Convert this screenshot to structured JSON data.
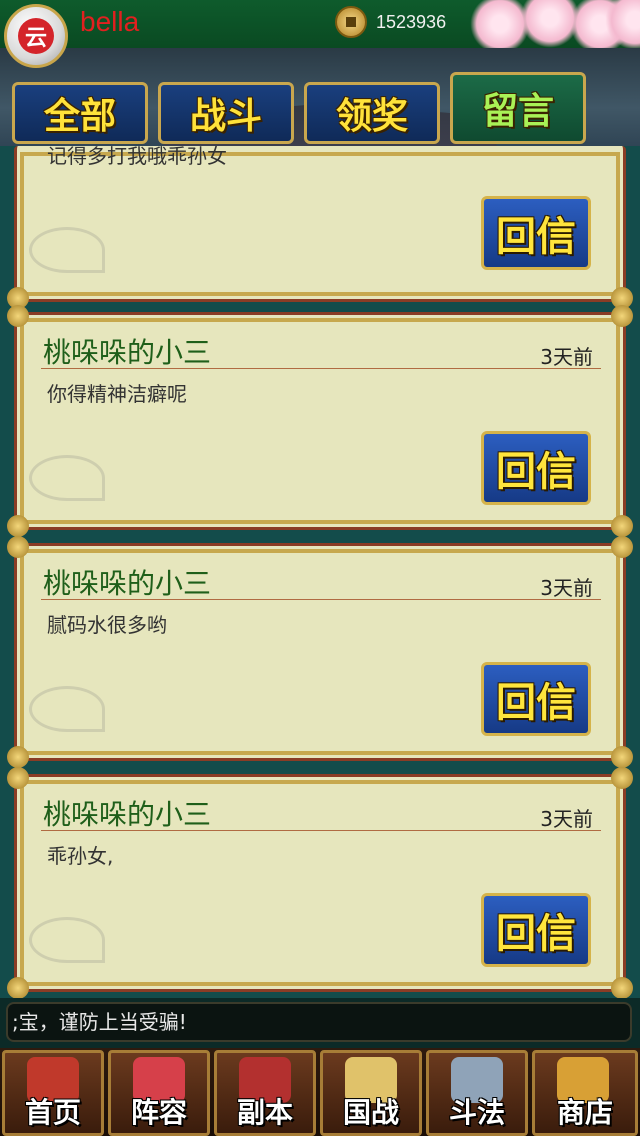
{
  "header": {
    "avatar_glyph": "云",
    "username": "bella",
    "coin_count": "1523936"
  },
  "tabs": [
    {
      "label": "全部",
      "active": false
    },
    {
      "label": "战斗",
      "active": false
    },
    {
      "label": "领奖",
      "active": false
    },
    {
      "label": "留言",
      "active": true
    }
  ],
  "messages": {
    "partial_text": "记得多打我哦乖孙女",
    "reply_label": "回信",
    "items": [
      {
        "sender": "桃哚哚的小三",
        "time": "3天前",
        "text": "你得精神洁癖呢"
      },
      {
        "sender": "桃哚哚的小三",
        "time": "3天前",
        "text": "腻码水很多哟"
      },
      {
        "sender": "桃哚哚的小三",
        "time": "3天前",
        "text": "乖孙女,"
      }
    ]
  },
  "marquee": {
    "text": ";宝，谨防上当受骗!"
  },
  "bottom_nav": [
    {
      "label": "首页",
      "icon": "home-icon",
      "color": "#c0392b"
    },
    {
      "label": "阵容",
      "icon": "lineup-icon",
      "color": "#d6404a"
    },
    {
      "label": "副本",
      "icon": "dungeon-icon",
      "color": "#b3302f"
    },
    {
      "label": "国战",
      "icon": "war-icon",
      "color": "#e0c26a"
    },
    {
      "label": "斗法",
      "icon": "battle-icon",
      "color": "#8fa3b8"
    },
    {
      "label": "商店",
      "icon": "shop-icon",
      "color": "#d8a035"
    }
  ],
  "colors": {
    "tab_text": "#ffe23a",
    "active_tab_text": "#a9f256",
    "card_bg": "#e6e6bd",
    "reply_bg": "#1f4fa5"
  }
}
